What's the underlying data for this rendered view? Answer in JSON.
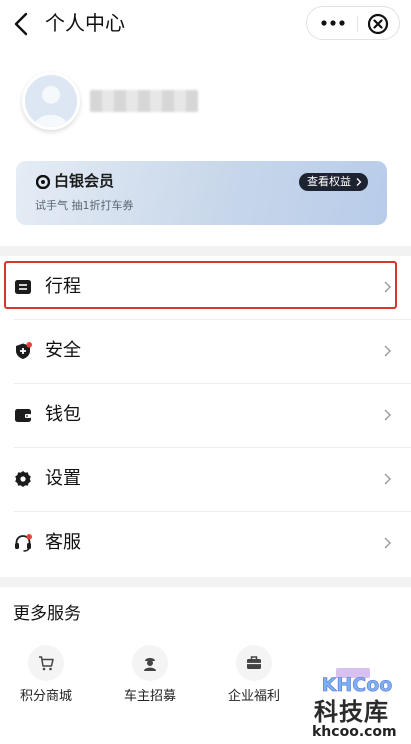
{
  "header": {
    "title": "个人中心",
    "more_icon": "more-dots-icon",
    "close_icon": "close-circle-icon",
    "back_icon": "chevron-left-icon"
  },
  "profile": {
    "avatar_icon": "default-avatar-icon",
    "username": ""
  },
  "member_card": {
    "level": "白银会员",
    "subtitle": "试手气 抽1折打车券",
    "rights_button": "查看权益"
  },
  "menu": {
    "items": [
      {
        "label": "行程",
        "icon": "itinerary-icon"
      },
      {
        "label": "安全",
        "icon": "shield-plus-icon"
      },
      {
        "label": "钱包",
        "icon": "wallet-icon"
      },
      {
        "label": "设置",
        "icon": "gear-icon"
      },
      {
        "label": "客服",
        "icon": "headset-icon"
      }
    ]
  },
  "services": {
    "title": "更多服务",
    "items": [
      {
        "label": "积分商城",
        "icon": "cart-icon"
      },
      {
        "label": "车主招募",
        "icon": "driver-icon"
      },
      {
        "label": "企业福利",
        "icon": "briefcase-icon"
      }
    ]
  },
  "watermark": {
    "logo": "KHCoo",
    "name": "科技库",
    "url": "khcoo.com"
  },
  "colors": {
    "highlight": "#d8362b",
    "badge": "#e8413a",
    "card_gradient_end": "#b8ccea"
  }
}
